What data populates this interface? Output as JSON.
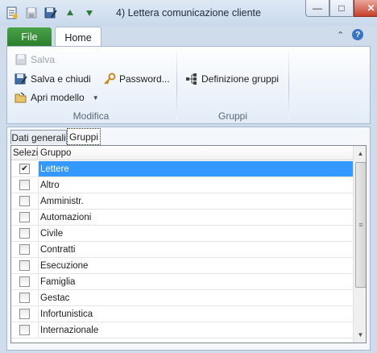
{
  "window": {
    "title": "4) Lettera comunicazione cliente",
    "controls": {
      "minimize": "—",
      "maximize": "□",
      "close": "✕"
    }
  },
  "quick_access": {
    "icons": [
      "app-icon",
      "save-icon",
      "save-close-icon",
      "up-arrow-icon",
      "down-arrow-icon"
    ]
  },
  "ribbon": {
    "tabs": {
      "file": "File",
      "home": "Home"
    },
    "right": {
      "help": "?",
      "minimize": "⌃"
    },
    "groups": {
      "modifica": {
        "label": "Modifica",
        "salva": "Salva",
        "salva_chiudi": "Salva e chiudi",
        "apri_modello": "Apri modello",
        "password": "Password..."
      },
      "gruppi": {
        "label": "Gruppi",
        "definizione": "Definizione gruppi"
      }
    }
  },
  "tabs": {
    "dati_generali": "Dati generali",
    "gruppi": "Gruppi"
  },
  "grid": {
    "headers": {
      "select": "Selezi",
      "group": "Gruppo"
    },
    "rows": [
      {
        "checked": true,
        "label": "Lettere",
        "selected": true
      },
      {
        "checked": false,
        "label": "Altro"
      },
      {
        "checked": false,
        "label": "Amministr."
      },
      {
        "checked": false,
        "label": "Automazioni"
      },
      {
        "checked": false,
        "label": "Civile"
      },
      {
        "checked": false,
        "label": "Contratti"
      },
      {
        "checked": false,
        "label": "Esecuzione"
      },
      {
        "checked": false,
        "label": "Famiglia"
      },
      {
        "checked": false,
        "label": "Gestac"
      },
      {
        "checked": false,
        "label": "Infortunistica"
      },
      {
        "checked": false,
        "label": "Internazionale"
      }
    ],
    "check_mark": "✔",
    "scroll": {
      "up": "▲",
      "down": "▼",
      "grip": "≡"
    }
  },
  "colors": {
    "selection": "#3399ff",
    "file_tab": "#2c7f2c"
  }
}
